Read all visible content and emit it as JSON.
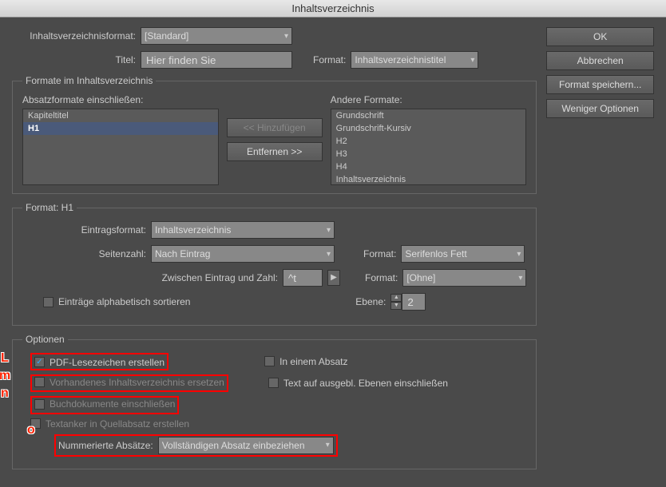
{
  "title": "Inhaltsverzeichnis",
  "labels": {
    "tocFormat": "Inhaltsverzeichnisformat:",
    "titel": "Titel:",
    "format": "Format:",
    "formatsSection": "Formate im Inhaltsverzeichnis",
    "includeFormats": "Absatzformate einschließen:",
    "otherFormats": "Andere Formate:",
    "add": "<< Hinzufügen",
    "remove": "Entfernen >>",
    "formatH1": "Format: H1",
    "entryFormat": "Eintragsformat:",
    "pageNumber": "Seitenzahl:",
    "betweenEntry": "Zwischen Eintrag und Zahl:",
    "sortAlpha": "Einträge alphabetisch sortieren",
    "level": "Ebene:",
    "options": "Optionen",
    "pdfBookmarks": "PDF-Lesezeichen erstellen",
    "replaceExisting": "Vorhandenes Inhaltsverzeichnis ersetzen",
    "includeBook": "Buchdokumente einschließen",
    "textAnchor": "Textanker in Quellabsatz erstellen",
    "inOnePara": "In einem Absatz",
    "textHidden": "Text auf ausgebl. Ebenen einschließen",
    "numberedPara": "Nummerierte Absätze:"
  },
  "values": {
    "tocFormat": "[Standard]",
    "titel": "Hier finden Sie",
    "titleFormat": "Inhaltsverzeichnistitel",
    "entryFormat": "Inhaltsverzeichnis",
    "pageNumber": "Nach Eintrag",
    "pageFormat": "Serifenlos Fett",
    "betweenChar": "^t",
    "betweenFormat": "[Ohne]",
    "level": "2",
    "numberedPara": "Vollständigen Absatz einbeziehen"
  },
  "includeList": [
    "Kapiteltitel",
    "H1"
  ],
  "otherList": [
    "Grundschrift",
    "Grundschrift-Kursiv",
    "H2",
    "H3",
    "H4",
    "Inhaltsverzeichnis"
  ],
  "buttons": {
    "ok": "OK",
    "cancel": "Abbrechen",
    "saveFormat": "Format speichern...",
    "fewerOptions": "Weniger Optionen"
  },
  "markers": {
    "L": "L",
    "m": "m",
    "n": "n",
    "o": "o"
  }
}
